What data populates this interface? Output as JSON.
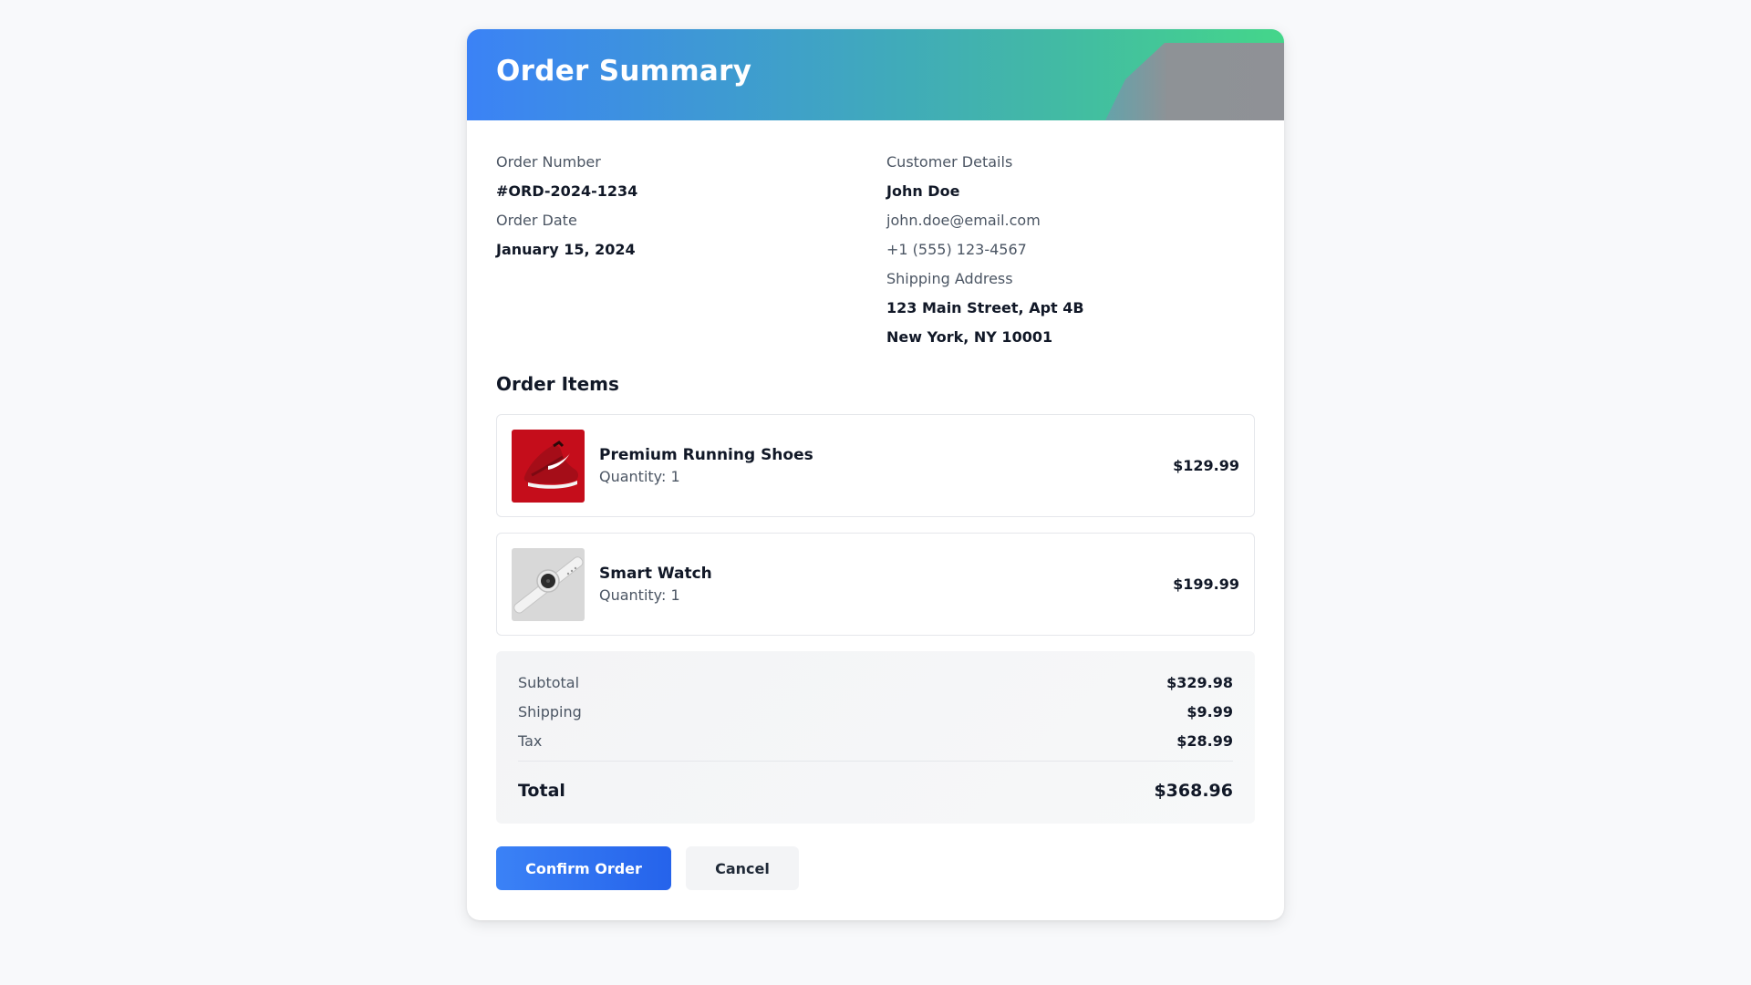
{
  "header": {
    "title": "Order Summary"
  },
  "order": {
    "number_label": "Order Number",
    "number_value": "#ORD-2024-1234",
    "date_label": "Order Date",
    "date_value": "January 15, 2024"
  },
  "customer": {
    "label": "Customer Details",
    "name": "John Doe",
    "email": "john.doe@email.com",
    "phone": "+1 (555) 123-4567",
    "shipping_label": "Shipping Address",
    "address_line1": "123 Main Street, Apt 4B",
    "address_line2": "New York, NY 10001"
  },
  "items_section": {
    "title": "Order Items",
    "items": [
      {
        "name": "Premium Running Shoes",
        "quantity": "Quantity: 1",
        "price": "$129.99",
        "image": "red-running-shoe"
      },
      {
        "name": "Smart Watch",
        "quantity": "Quantity: 1",
        "price": "$199.99",
        "image": "white-smart-watch"
      }
    ]
  },
  "summary": {
    "subtotal_label": "Subtotal",
    "subtotal_value": "$329.98",
    "shipping_label": "Shipping",
    "shipping_value": "$9.99",
    "tax_label": "Tax",
    "tax_value": "$28.99",
    "total_label": "Total",
    "total_value": "$368.96"
  },
  "actions": {
    "confirm_label": "Confirm Order",
    "cancel_label": "Cancel"
  },
  "colors": {
    "header_start": "#3b82f6",
    "header_end": "#44d68a",
    "primary": "#3b82f6"
  }
}
